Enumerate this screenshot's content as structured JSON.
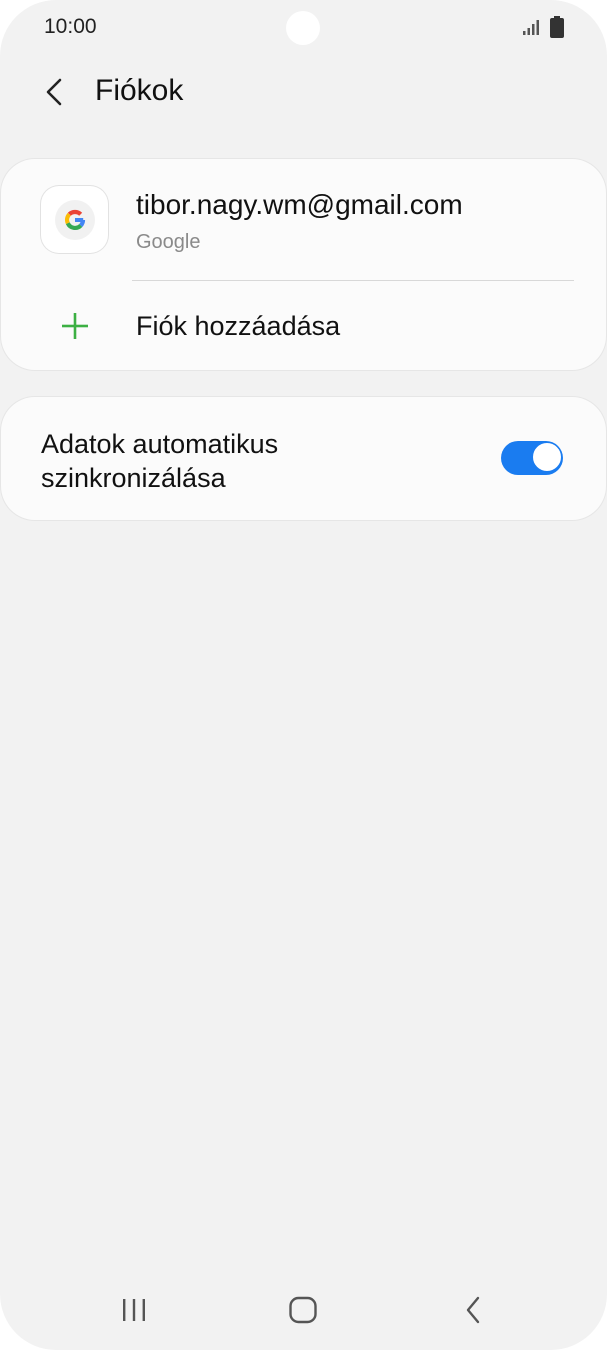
{
  "status_bar": {
    "time": "10:00"
  },
  "app_bar": {
    "title": "Fiókok"
  },
  "accounts": {
    "items": [
      {
        "email": "tibor.nagy.wm@gmail.com",
        "type": "Google",
        "icon": "google-logo-icon"
      }
    ],
    "add_label": "Fiók hozzáadása"
  },
  "sync": {
    "label": "Adatok automatikus szinkronizálása",
    "enabled": true
  },
  "colors": {
    "background": "#f2f2f2",
    "card": "#fbfbfb",
    "accent": "#1a7cf0",
    "add_icon": "#3cb043"
  }
}
